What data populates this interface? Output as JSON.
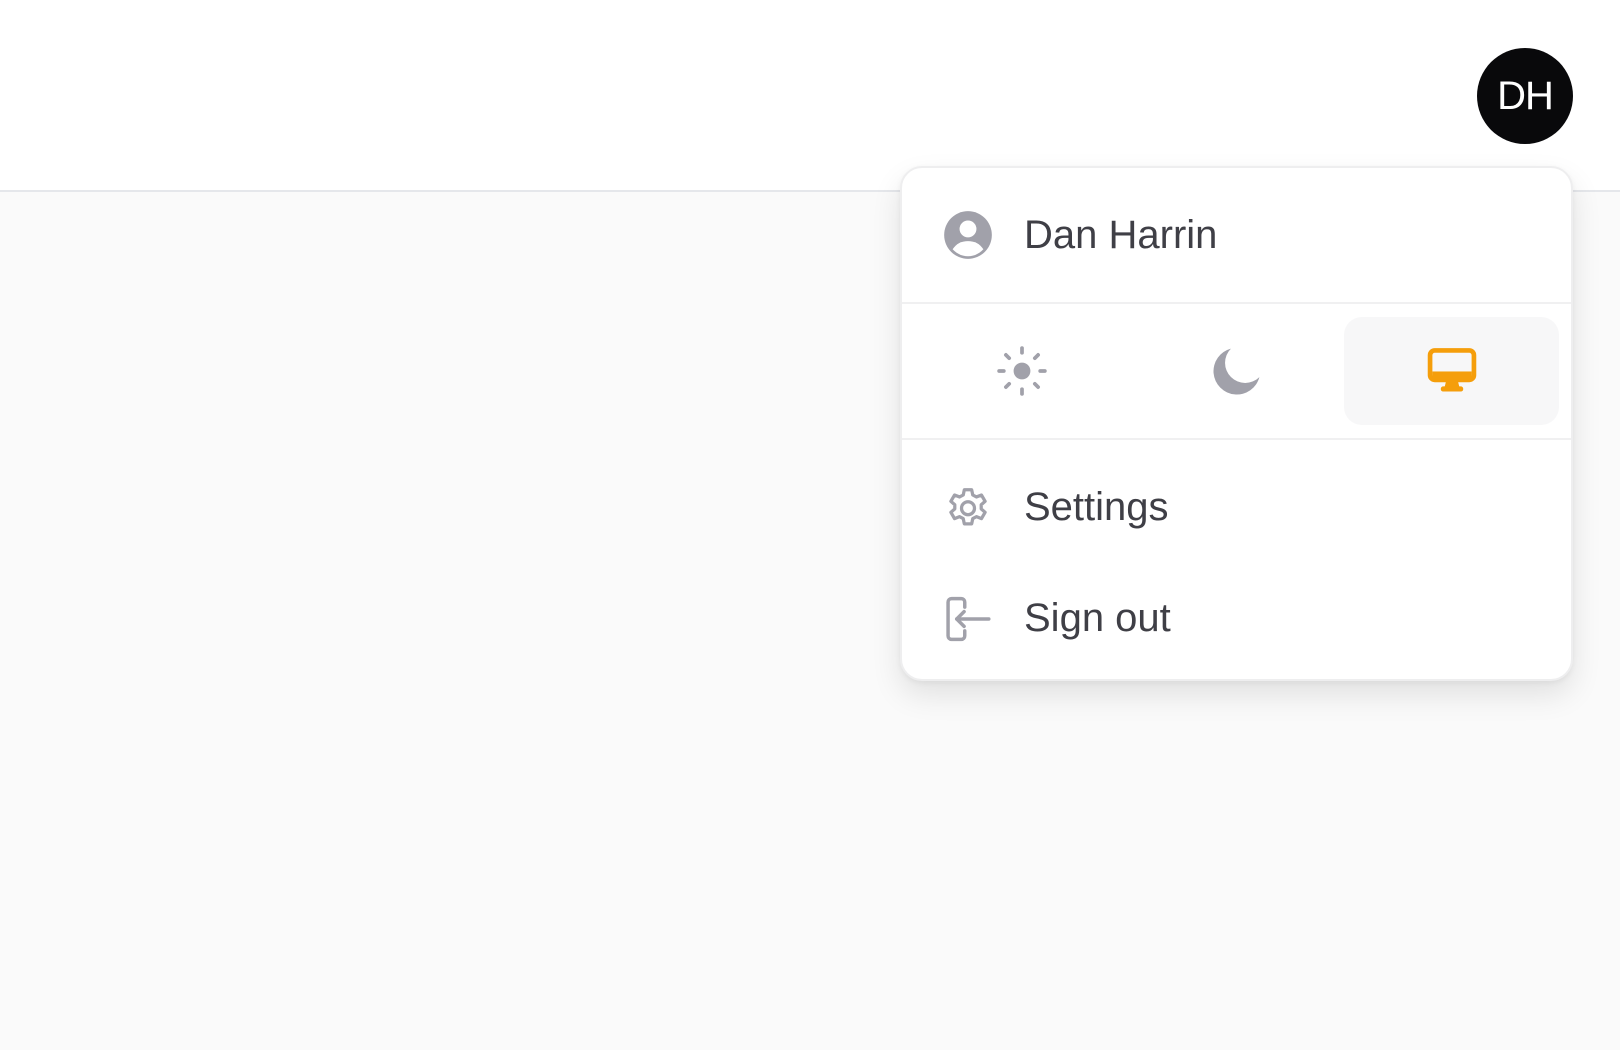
{
  "avatar": {
    "initials": "DH",
    "icon": "avatar"
  },
  "user_menu": {
    "user_name": "Dan Harrin",
    "user_icon": "user-circle-icon",
    "theme_switcher": {
      "options": [
        {
          "key": "light",
          "icon": "sun-icon",
          "active": false
        },
        {
          "key": "dark",
          "icon": "moon-icon",
          "active": false
        },
        {
          "key": "system",
          "icon": "computer-desktop-icon",
          "active": true
        }
      ]
    },
    "items": [
      {
        "label": "Settings",
        "icon": "gear-icon"
      },
      {
        "label": "Sign out",
        "icon": "sign-out-icon"
      }
    ]
  },
  "colors": {
    "accent": "#f59e0b",
    "icon_gray": "#a1a1aa",
    "text": "#3f3f46",
    "avatar_bg": "#09090b"
  }
}
